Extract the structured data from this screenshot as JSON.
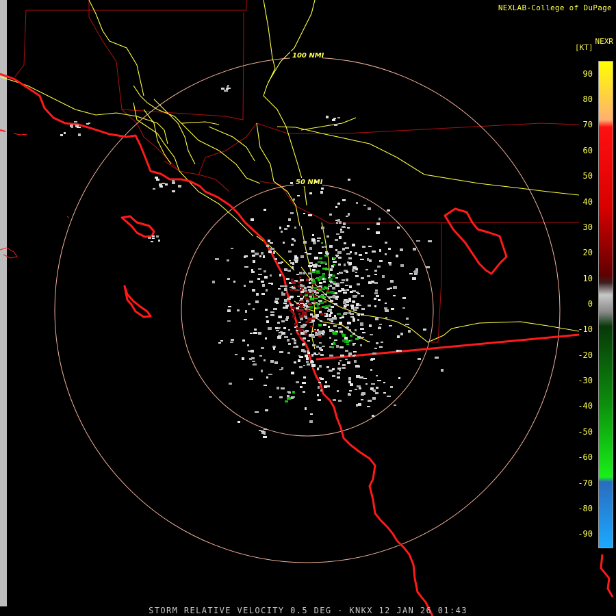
{
  "header": {
    "credit": "NEXLAB-College of DuPage",
    "product_code": "NEXR",
    "unit": "[KT]"
  },
  "footer": {
    "caption": "STORM RELATIVE VELOCITY 0.5 DEG - KNKX 12 JAN 26 01:43"
  },
  "range_rings": [
    {
      "label": "100 NMI"
    },
    {
      "label": "50 NMI"
    }
  ],
  "legend": {
    "ticks": [
      "90",
      "80",
      "70",
      "60",
      "50",
      "40",
      "30",
      "20",
      "10",
      "0",
      "-10",
      "-20",
      "-30",
      "-40",
      "-50",
      "-60",
      "-70",
      "-80",
      "-90"
    ],
    "max_value": 95,
    "min_value": -95
  },
  "colors": {
    "background": "#000000",
    "coastline": "#ff1a1a",
    "state_border": "#b01010",
    "county_border": "#b01010",
    "highway": "#ffff44",
    "range_ring": "#f4b49c",
    "label_text": "#ffff55",
    "inbound_green": "#12c012",
    "outbound_red": "#8c0c0c",
    "near_zero_gray": "#c0c0c0"
  }
}
